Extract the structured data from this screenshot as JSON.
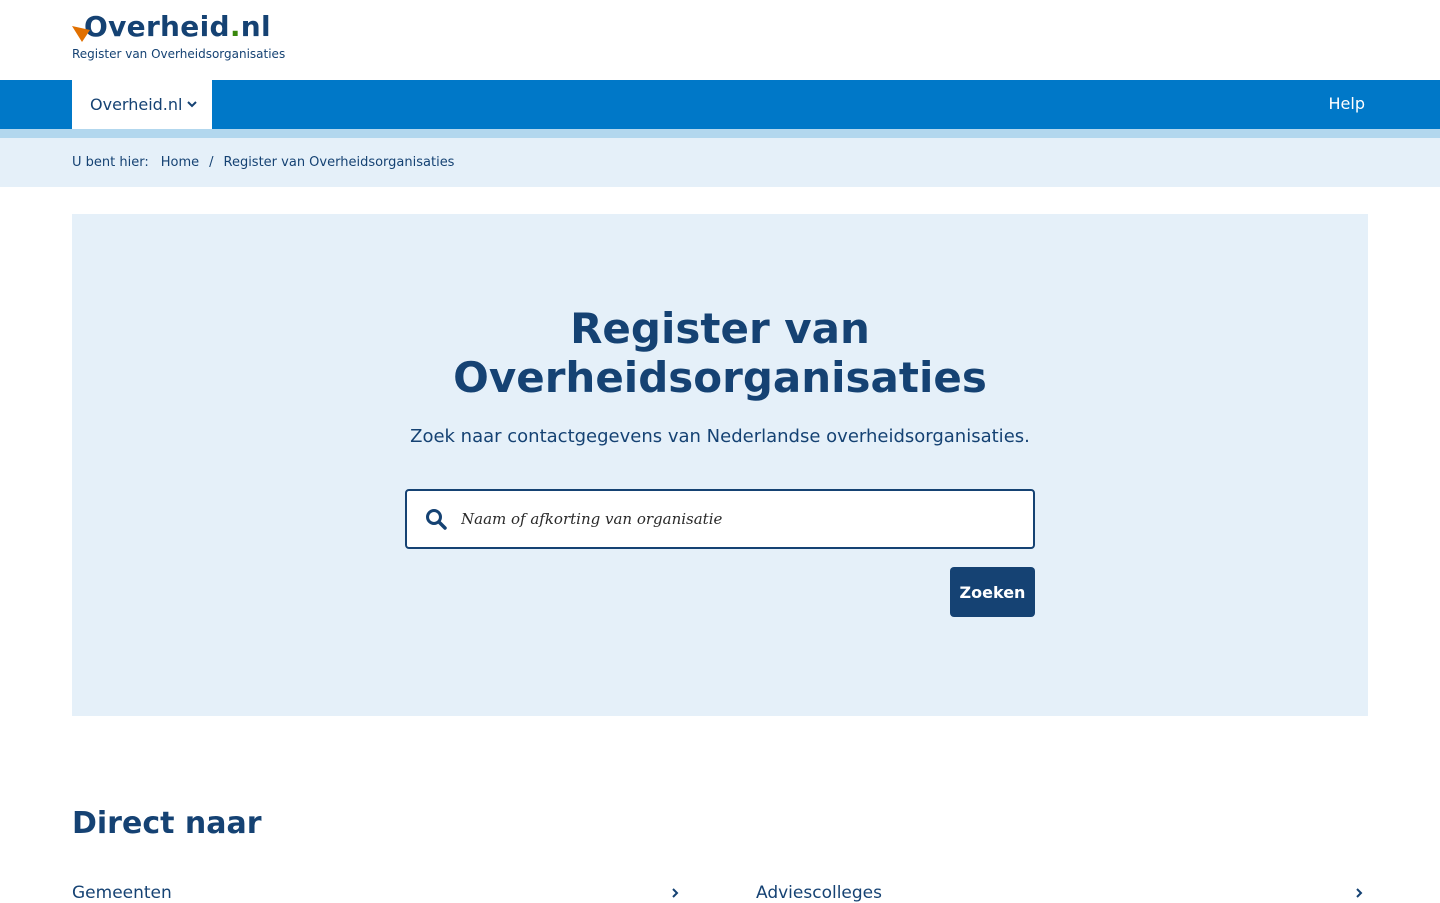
{
  "header": {
    "logo_main": "Overheid",
    "logo_dot": ".",
    "logo_tld": "nl",
    "logo_subtitle": "Register van Overheidsorganisaties"
  },
  "nav": {
    "dropdown_label": "Overheid.nl",
    "help_label": "Help"
  },
  "breadcrumb": {
    "label": "U bent hier:",
    "items": [
      "Home",
      "Register van Overheidsorganisaties"
    ],
    "separator": "/"
  },
  "hero": {
    "title_line1": "Register van",
    "title_line2": "Overheidsorganisaties",
    "subtitle": "Zoek naar contactgegevens van Nederlandse overheidsorganisaties.",
    "search_placeholder": "Naam of afkorting van organisatie",
    "search_value": "",
    "search_button": "Zoeken"
  },
  "direct": {
    "title": "Direct naar",
    "items": [
      "Gemeenten",
      "Adviescolleges"
    ]
  },
  "colors": {
    "brand_dark": "#154273",
    "nav_blue": "#0078c8",
    "light_blue": "#e5f0f9",
    "stripe": "#b2d7ee",
    "logo_orange": "#e17000"
  }
}
